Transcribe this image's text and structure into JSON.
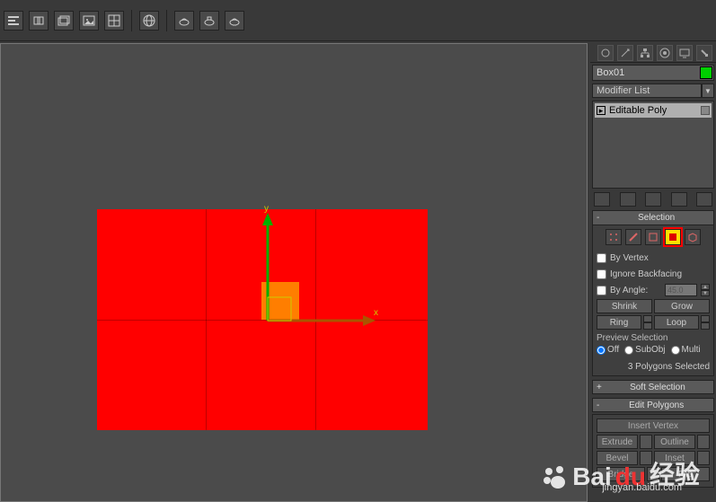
{
  "toolbar_icons": [
    "align",
    "link",
    "layer",
    "image",
    "grid",
    "globe",
    "teapot1",
    "teapot2",
    "teapot3"
  ],
  "object": {
    "name": "Box01",
    "color": "#00d000"
  },
  "modifier_list_label": "Modifier List",
  "stack": {
    "item_label": "Editable Poly"
  },
  "rollouts": {
    "selection": {
      "title": "Selection",
      "by_vertex": "By Vertex",
      "ignore_backfacing": "Ignore Backfacing",
      "by_angle": "By Angle:",
      "angle_value": "45.0",
      "shrink": "Shrink",
      "grow": "Grow",
      "ring": "Ring",
      "loop": "Loop",
      "preview_label": "Preview Selection",
      "preview_off": "Off",
      "preview_subobj": "SubObj",
      "preview_multi": "Multi",
      "selected_info": "3 Polygons Selected"
    },
    "soft_selection": {
      "title": "Soft Selection"
    },
    "edit_polygons": {
      "title": "Edit Polygons",
      "insert_vertex": "Insert Vertex",
      "extrude": "Extrude",
      "outline": "Outline",
      "bevel": "Bevel",
      "inset": "Inset",
      "bridge": "Bridge",
      "flip": "Flip"
    }
  },
  "viewport": {
    "axis_y": "y",
    "axis_x": "x"
  },
  "watermark": {
    "brand": "Bai",
    "brand2": "du",
    "brand3": "经验",
    "url": "jingyan.baidu.com"
  }
}
